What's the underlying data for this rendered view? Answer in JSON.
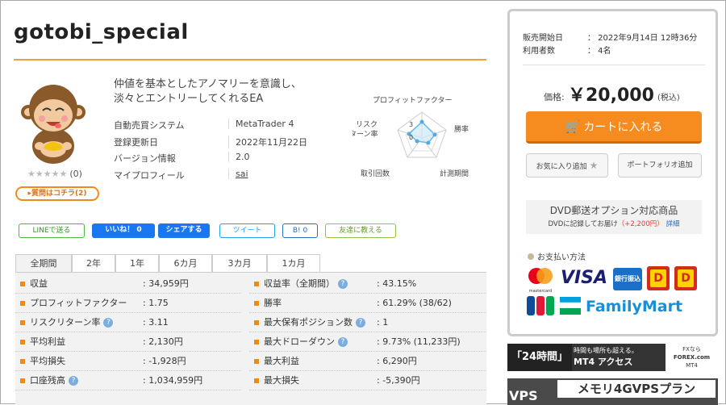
{
  "product": {
    "title": "gotobi_special",
    "description_line1": "仲値を基本としたアノマリーを意識し、",
    "description_line2": "淡々とエントリーしてくれるEA",
    "rating_stars": "★★★★★",
    "rating_count": "(0)",
    "question_button": "▸質問はコチラ(2)"
  },
  "info": [
    {
      "label": "自動売買システム",
      "value": "MetaTrader 4"
    },
    {
      "label": "登録更新日",
      "value": "2022年11月22日"
    },
    {
      "label": "バージョン情報",
      "value": "2.0"
    },
    {
      "label": "マイプロフィール",
      "value": "sai"
    }
  ],
  "radar": {
    "labels": {
      "top": "プロフィットファクター",
      "right": "勝率",
      "bottom_right": "計測期間",
      "bottom_left": "取引回数",
      "left": "リスク\nターン率"
    },
    "left_label_line1": "リスク",
    "left_label_line2": "ターン率",
    "tick_3": "3",
    "tick_0": "0"
  },
  "social": {
    "line": "LINEで送る",
    "like": "いいね！ 0",
    "share": "シェアする",
    "tweet": "ツイート",
    "hatena": "B! 0",
    "friend": "友達に教える"
  },
  "tabs": [
    "全期間",
    "2年",
    "1年",
    "6カ月",
    "3カ月",
    "1カ月"
  ],
  "stats_left": [
    {
      "label": "収益",
      "value": ": 34,959円",
      "help": false
    },
    {
      "label": "プロフィットファクター",
      "value": ": 1.75",
      "help": false
    },
    {
      "label": "リスクリターン率",
      "value": ": 3.11",
      "help": true
    },
    {
      "label": "平均利益",
      "value": ": 2,130円",
      "help": false
    },
    {
      "label": "平均損失",
      "value": ": -1,928円",
      "help": false
    },
    {
      "label": "口座残高",
      "value": ": 1,034,959円",
      "help": true
    }
  ],
  "stats_right": [
    {
      "label": "収益率（全期間）",
      "value": ": 43.15%",
      "help": true
    },
    {
      "label": "勝率",
      "value": ": 61.29% (38/62)",
      "help": false
    },
    {
      "label": "最大保有ポジション数",
      "value": ": 1",
      "help": true
    },
    {
      "label": "最大ドローダウン",
      "value": ": 9.73% (11,233円)",
      "help": true
    },
    {
      "label": "最大利益",
      "value": ": 6,290円",
      "help": false
    },
    {
      "label": "最大損失",
      "value": ": -5,390円",
      "help": false
    }
  ],
  "sidebar": {
    "sale_start_label": "販売開始日",
    "sale_start_value": "：  2022年9月14日 12時36分",
    "users_label": "利用者数",
    "users_value": "：  4名",
    "price_label": "価格:",
    "price": "￥20,000",
    "tax": "(税込)",
    "cart_button": "カートに入れる",
    "favorite_button": "お気に入り追加",
    "portfolio_button": "ポートフォリオ追加",
    "dvd_title": "DVD郵送オプション対応商品",
    "dvd_sub_text": "DVDに記録してお届け",
    "dvd_sub_price": "（+2,200円）",
    "dvd_sub_link": "詳細",
    "payment_heading": "お支払い方法",
    "payment_visa": "VISA",
    "payment_bank": "銀行振込",
    "payment_familymart": "FamilyMart",
    "payment_mastercard": "mastercard"
  },
  "banners": {
    "banner1_left": "「24時間」",
    "banner1_mid_line1": "時間も場所も超える。",
    "banner1_mid_line2": "MT4 アクセス",
    "banner1_right_line1": "FXなら",
    "banner1_right_line2": "FOREX.com",
    "banner1_right_line3": "MT4",
    "banner2": "メモリ4GVPSプラン",
    "banner2_left": "VPS"
  }
}
